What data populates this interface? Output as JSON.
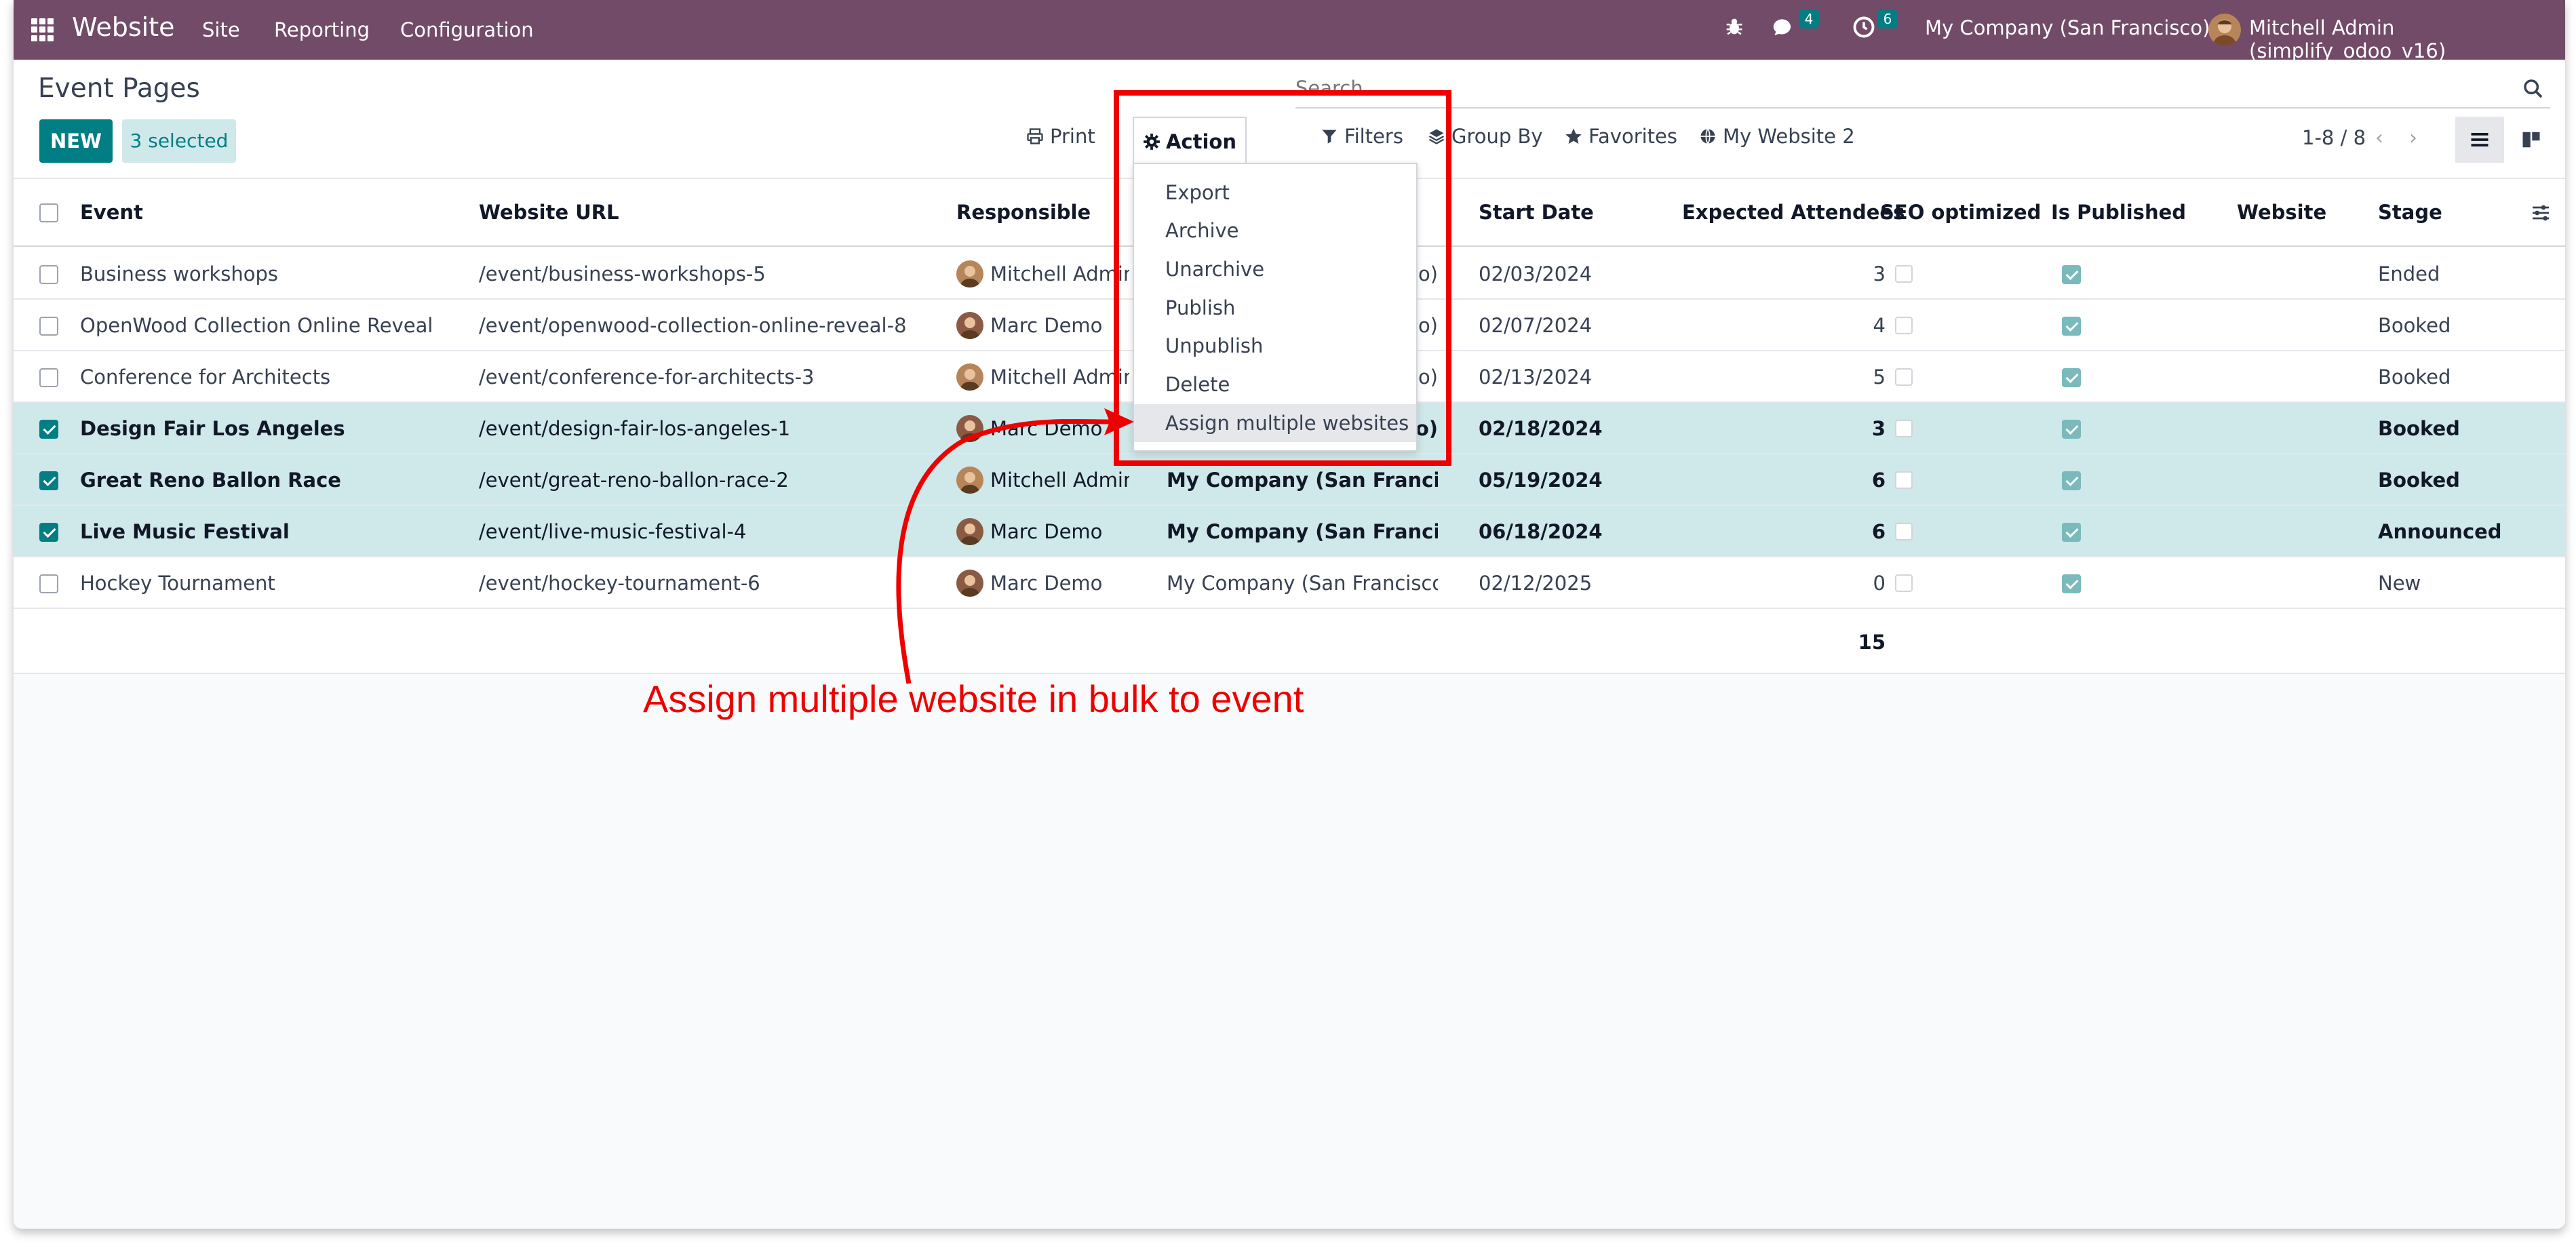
{
  "navbar": {
    "brand": "Website",
    "menus": [
      "Site",
      "Reporting",
      "Configuration"
    ],
    "messages_badge": "4",
    "activities_badge": "6",
    "company": "My Company (San Francisco)",
    "user": "Mitchell Admin (simplify_odoo_v16)"
  },
  "control": {
    "title": "Event Pages",
    "new_label": "NEW",
    "selected_label": "3 selected",
    "search_placeholder": "Search...",
    "print_label": "Print",
    "action_label": "Action",
    "filters_label": "Filters",
    "groupby_label": "Group By",
    "favorites_label": "Favorites",
    "website_label": "My Website 2",
    "pager": "1-8 / 8"
  },
  "table": {
    "headers": {
      "event": "Event",
      "url": "Website URL",
      "responsible": "Responsible",
      "start": "Start Date",
      "attendees": "Expected Attendees",
      "seo": "SEO optimized",
      "published": "Is Published",
      "website": "Website",
      "stage": "Stage"
    },
    "rows": [
      {
        "event": "Business workshops",
        "url": "/event/business-workshops-5",
        "responsible": "Mitchell Admin",
        "company": "o)",
        "start": "02/03/2024",
        "attendees": "3",
        "stage": "Ended"
      },
      {
        "event": "OpenWood Collection Online Reveal",
        "url": "/event/openwood-collection-online-reveal-8",
        "responsible": "Marc Demo",
        "company": "o)",
        "start": "02/07/2024",
        "attendees": "4",
        "stage": "Booked"
      },
      {
        "event": "Conference for Architects",
        "url": "/event/conference-for-architects-3",
        "responsible": "Mitchell Admin",
        "company": "o)",
        "start": "02/13/2024",
        "attendees": "5",
        "stage": "Booked"
      },
      {
        "event": "Design Fair Los Angeles",
        "url": "/event/design-fair-los-angeles-1",
        "responsible": "Marc Demo",
        "company": "o)",
        "start": "02/18/2024",
        "attendees": "3",
        "stage": "Booked"
      },
      {
        "event": "Great Reno Ballon Race",
        "url": "/event/great-reno-ballon-race-2",
        "responsible": "Mitchell Admin",
        "company": "My Company (San Francisco)",
        "start": "05/19/2024",
        "attendees": "6",
        "stage": "Booked"
      },
      {
        "event": "Live Music Festival",
        "url": "/event/live-music-festival-4",
        "responsible": "Marc Demo",
        "company": "My Company (San Francisco)",
        "start": "06/18/2024",
        "attendees": "6",
        "stage": "Announced"
      },
      {
        "event": "Hockey Tournament",
        "url": "/event/hockey-tournament-6",
        "responsible": "Marc Demo",
        "company": "My Company (San Francisco)",
        "start": "02/12/2025",
        "attendees": "0",
        "stage": "New"
      }
    ],
    "total_attendees": "15"
  },
  "action_menu": {
    "items": [
      "Export",
      "Archive",
      "Unarchive",
      "Publish",
      "Unpublish",
      "Delete",
      "Assign multiple websites"
    ]
  },
  "annotation": {
    "text": "Assign multiple website in bulk to event"
  },
  "colors": {
    "navbar": "#714b67",
    "primary": "#017e84",
    "selected_row": "#cfe8ea",
    "annotation": "#ee0000"
  }
}
